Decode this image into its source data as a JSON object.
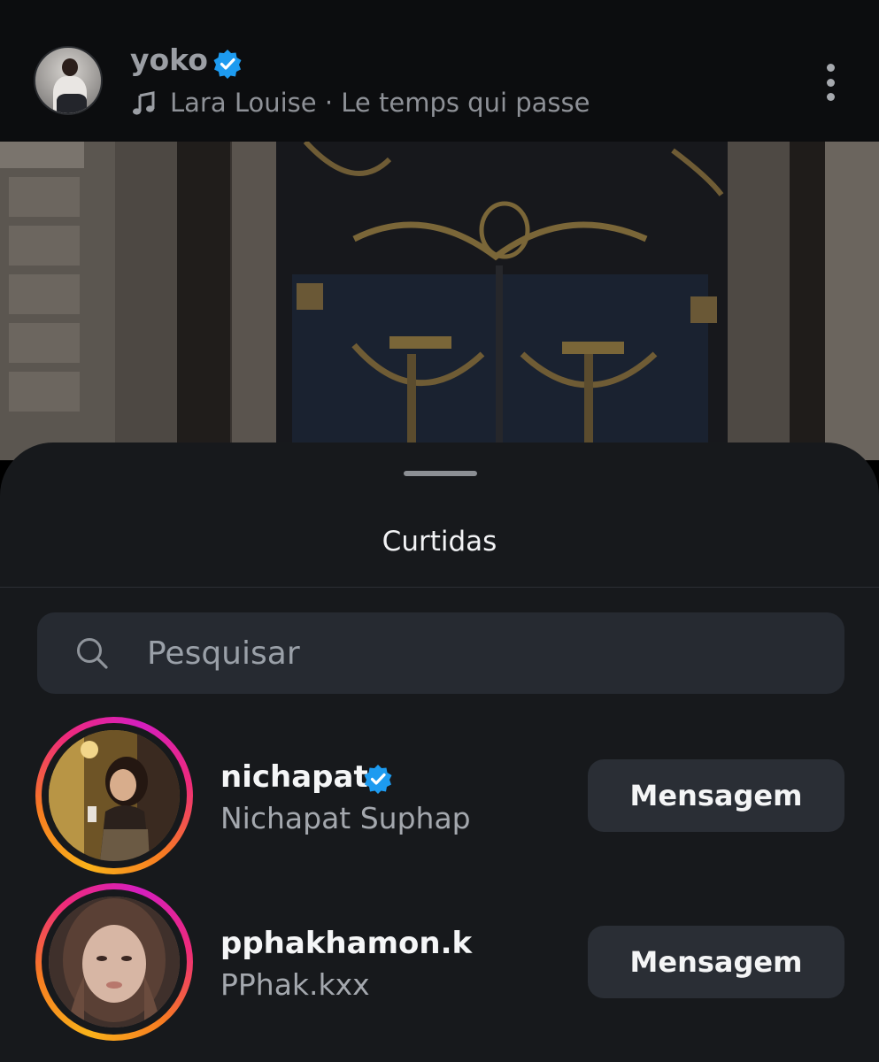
{
  "post_header": {
    "username": "yoko",
    "song": "Lara Louise · Le temps qui passe"
  },
  "sheet": {
    "title": "Curtidas"
  },
  "search": {
    "placeholder": "Pesquisar",
    "value": ""
  },
  "users": [
    {
      "username": "nichapat",
      "full_name": "Nichapat Suphap",
      "verified": true,
      "button_label": "Mensagem"
    },
    {
      "username": "pphakhamon.k",
      "full_name": "PPhak.kxx",
      "verified": false,
      "button_label": "Mensagem"
    }
  ],
  "colors": {
    "verified_badge": "#1d9bf0",
    "story_ring_start": "#f9b21a",
    "story_ring_end": "#d51ebf",
    "sheet_background": "#17191c",
    "button_background": "#2a2e35"
  },
  "icons": {
    "verified": "verified-badge-icon",
    "music": "music-note-icon",
    "more": "more-vertical-icon",
    "search": "search-icon"
  }
}
